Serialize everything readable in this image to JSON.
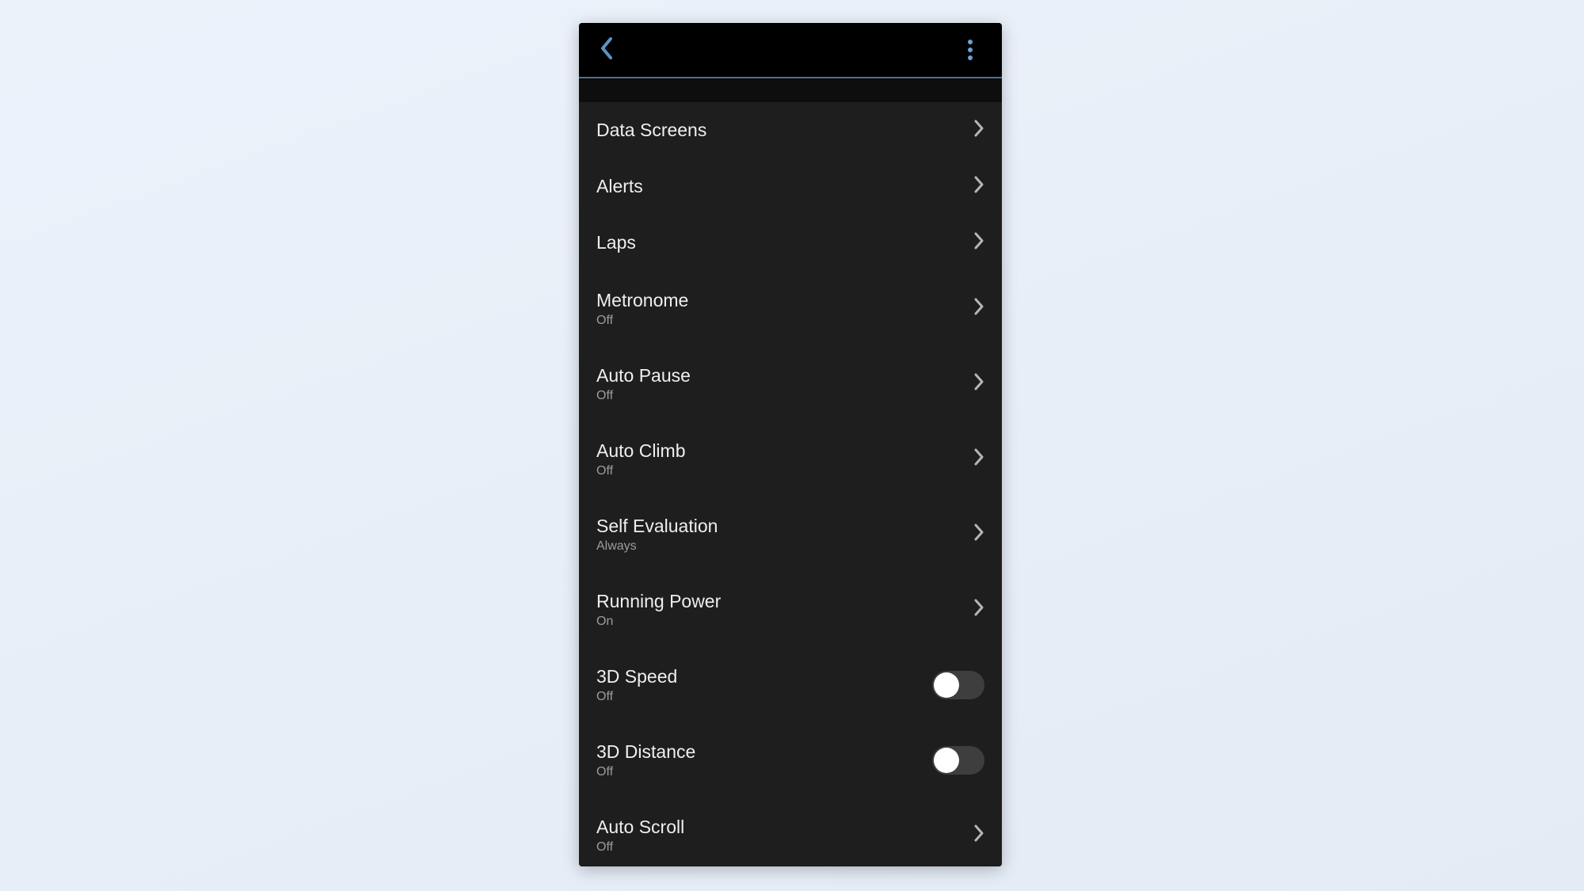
{
  "settings": {
    "items": [
      {
        "label": "Data Screens",
        "sub": null,
        "kind": "nav",
        "on": null
      },
      {
        "label": "Alerts",
        "sub": null,
        "kind": "nav",
        "on": null
      },
      {
        "label": "Laps",
        "sub": null,
        "kind": "nav",
        "on": null
      },
      {
        "label": "Metronome",
        "sub": "Off",
        "kind": "nav",
        "on": null
      },
      {
        "label": "Auto Pause",
        "sub": "Off",
        "kind": "nav",
        "on": null
      },
      {
        "label": "Auto Climb",
        "sub": "Off",
        "kind": "nav",
        "on": null
      },
      {
        "label": "Self Evaluation",
        "sub": "Always",
        "kind": "nav",
        "on": null
      },
      {
        "label": "Running Power",
        "sub": "On",
        "kind": "nav",
        "on": null
      },
      {
        "label": "3D Speed",
        "sub": "Off",
        "kind": "toggle",
        "on": false
      },
      {
        "label": "3D Distance",
        "sub": "Off",
        "kind": "toggle",
        "on": false
      },
      {
        "label": "Auto Scroll",
        "sub": "Off",
        "kind": "nav",
        "on": null
      }
    ]
  }
}
